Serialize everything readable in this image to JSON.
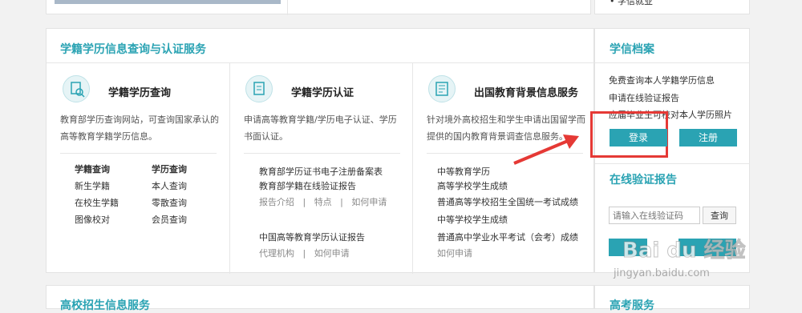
{
  "top": {
    "partial_link": "学信就业"
  },
  "section": {
    "title": "学籍学历信息查询与认证服务"
  },
  "columns": [
    {
      "title": "学籍学历查询",
      "desc": "教育部学历查询网站，可查询国家承认的高等教育学籍学历信息。",
      "headers": [
        "学籍查询",
        "学历查询"
      ],
      "links_left": [
        "新生学籍",
        "在校生学籍",
        "图像校对"
      ],
      "links_right": [
        "本人查询",
        "零散查询",
        "会员查询"
      ]
    },
    {
      "title": "学籍学历认证",
      "desc": "申请高等教育学籍/学历电子认证、学历书面认证。",
      "items": [
        "教育部学历证书电子注册备案表",
        "教育部学籍在线验证报告"
      ],
      "sub1": [
        "报告介绍",
        "特点",
        "如何申请"
      ],
      "item3": "中国高等教育学历认证报告",
      "sub2": [
        "代理机构",
        "如何申请"
      ]
    },
    {
      "title": "出国教育背景信息服务",
      "desc": "针对境外高校招生和学生申请出国留学而提供的国内教育背景调查信息服务。",
      "items": [
        "中等教育学历",
        "高等学校学生成绩",
        "普通高等学校招生全国统一考试成绩",
        "中等学校学生成绩",
        "普通高中学业水平考试（会考）成绩",
        "如何申请"
      ]
    }
  ],
  "sidebar": {
    "title": "学信档案",
    "lines": [
      "免费查询本人学籍学历信息",
      "申请在线验证报告",
      "应届毕业生可校对本人学历照片"
    ],
    "login": "登录",
    "register": "注册",
    "verify_title": "在线验证报告",
    "verify_placeholder": "请输入在线验证码",
    "verify_btn": "查询"
  },
  "bottom": {
    "left_title": "高校招生信息服务",
    "right_title": "高考服务"
  },
  "watermark": {
    "logo": "Bai du 经验",
    "url": "jingyan.baidu.com"
  },
  "colors": {
    "accent": "#2aa3b3",
    "highlight": "#e53935"
  }
}
